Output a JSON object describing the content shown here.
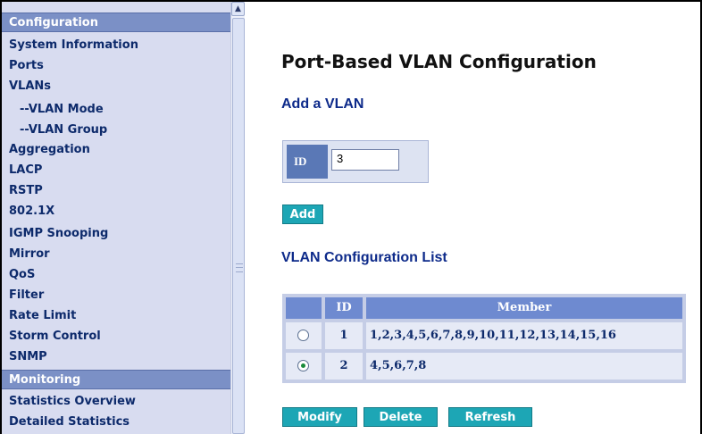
{
  "sidebar": {
    "items": [
      {
        "label": "Configuration",
        "type": "header"
      },
      {
        "label": "System Information"
      },
      {
        "label": "Ports"
      },
      {
        "label": "VLANs"
      },
      {
        "label": "--VLAN Mode"
      },
      {
        "label": "--VLAN Group"
      },
      {
        "label": "Aggregation"
      },
      {
        "label": "LACP"
      },
      {
        "label": "RSTP"
      },
      {
        "label": "802.1X"
      },
      {
        "label": "IGMP Snooping"
      },
      {
        "label": "Mirror"
      },
      {
        "label": "QoS"
      },
      {
        "label": "Filter"
      },
      {
        "label": "Rate Limit"
      },
      {
        "label": "Storm Control"
      },
      {
        "label": "SNMP"
      },
      {
        "label": "Monitoring",
        "type": "header"
      },
      {
        "label": "Statistics Overview"
      },
      {
        "label": "Detailed Statistics"
      }
    ]
  },
  "main": {
    "title": "Port-Based VLAN Configuration",
    "add_section_title": "Add a VLAN",
    "id_label": "ID",
    "id_value": "3",
    "add_button": "Add",
    "list_title": "VLAN Configuration List",
    "table": {
      "headers": [
        "ID",
        "Member"
      ],
      "rows": [
        {
          "id": "1",
          "member": "1,2,3,4,5,6,7,8,9,10,11,12,13,14,15,16",
          "selected": false
        },
        {
          "id": "2",
          "member": "4,5,6,7,8",
          "selected": true
        }
      ]
    },
    "buttons": {
      "modify": "Modify",
      "delete": "Delete",
      "refresh": "Refresh"
    }
  },
  "colors": {
    "sidebar_bg": "#d8dcf0",
    "sidebar_header": "#7b90c6",
    "button": "#1da6b5",
    "table_header": "#6e8ad0",
    "link_text": "#0d2a6b"
  }
}
